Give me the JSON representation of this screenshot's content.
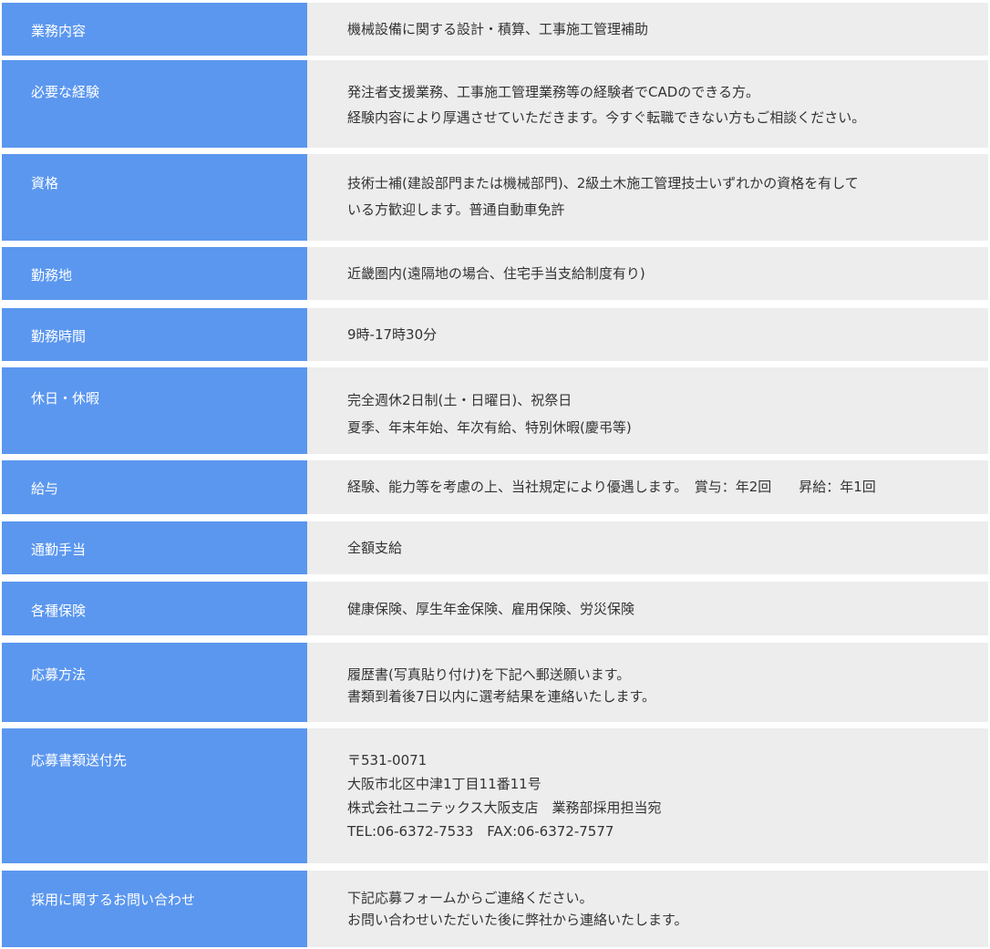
{
  "rows": [
    {
      "label": "業務内容",
      "lines": [
        "機械設備に関する設計・積算、工事施工管理補助"
      ]
    },
    {
      "label": "必要な経験",
      "lines": [
        "発注者支援業務、工事施工管理業務等の経験者でCADのできる方。",
        "経験内容により厚遇させていただきます。今すぐ転職できない方もご相談ください。"
      ]
    },
    {
      "label": "資格",
      "lines": [
        "技術士補(建設部門または機械部門)、2級土木施工管理技士いずれかの資格を有して",
        "いる方歓迎します。普通自動車免許"
      ]
    },
    {
      "label": "勤務地",
      "lines": [
        "近畿圏内(遠隔地の場合、住宅手当支給制度有り)"
      ]
    },
    {
      "label": "勤務時間",
      "lines": [
        "9時-17時30分"
      ]
    },
    {
      "label": "休日・休暇",
      "lines": [
        "完全週休2日制(土・日曜日)、祝祭日",
        "夏季、年末年始、年次有給、特別休暇(慶弔等)"
      ]
    },
    {
      "label": "給与",
      "lines": [
        "経験、能力等を考慮の上、当社規定により優遇します。　賞与：年2回　　昇給：年1回"
      ]
    },
    {
      "label": "通勤手当",
      "lines": [
        "全額支給"
      ]
    },
    {
      "label": "各種保険",
      "lines": [
        "健康保険、厚生年金保険、雇用保険、労災保険"
      ]
    },
    {
      "label": "応募方法",
      "lines": [
        "履歴書(写真貼り付け)を下記へ郵送願います。",
        "書類到着後7日以内に選考結果を連絡いたします。"
      ]
    },
    {
      "label": "応募書類送付先",
      "lines": [
        "〒531-0071",
        "大阪市北区中津1丁目11番11号",
        "株式会社ユニテックス大阪支店　業務部採用担当宛",
        "TEL:06-6372-7533　FAX:06-6372-7577"
      ]
    },
    {
      "label": "採用に関するお問い合わせ",
      "lines": [
        "下記応募フォームからご連絡ください。",
        "お問い合わせいただいた後に弊社から連絡いたします。"
      ]
    }
  ]
}
